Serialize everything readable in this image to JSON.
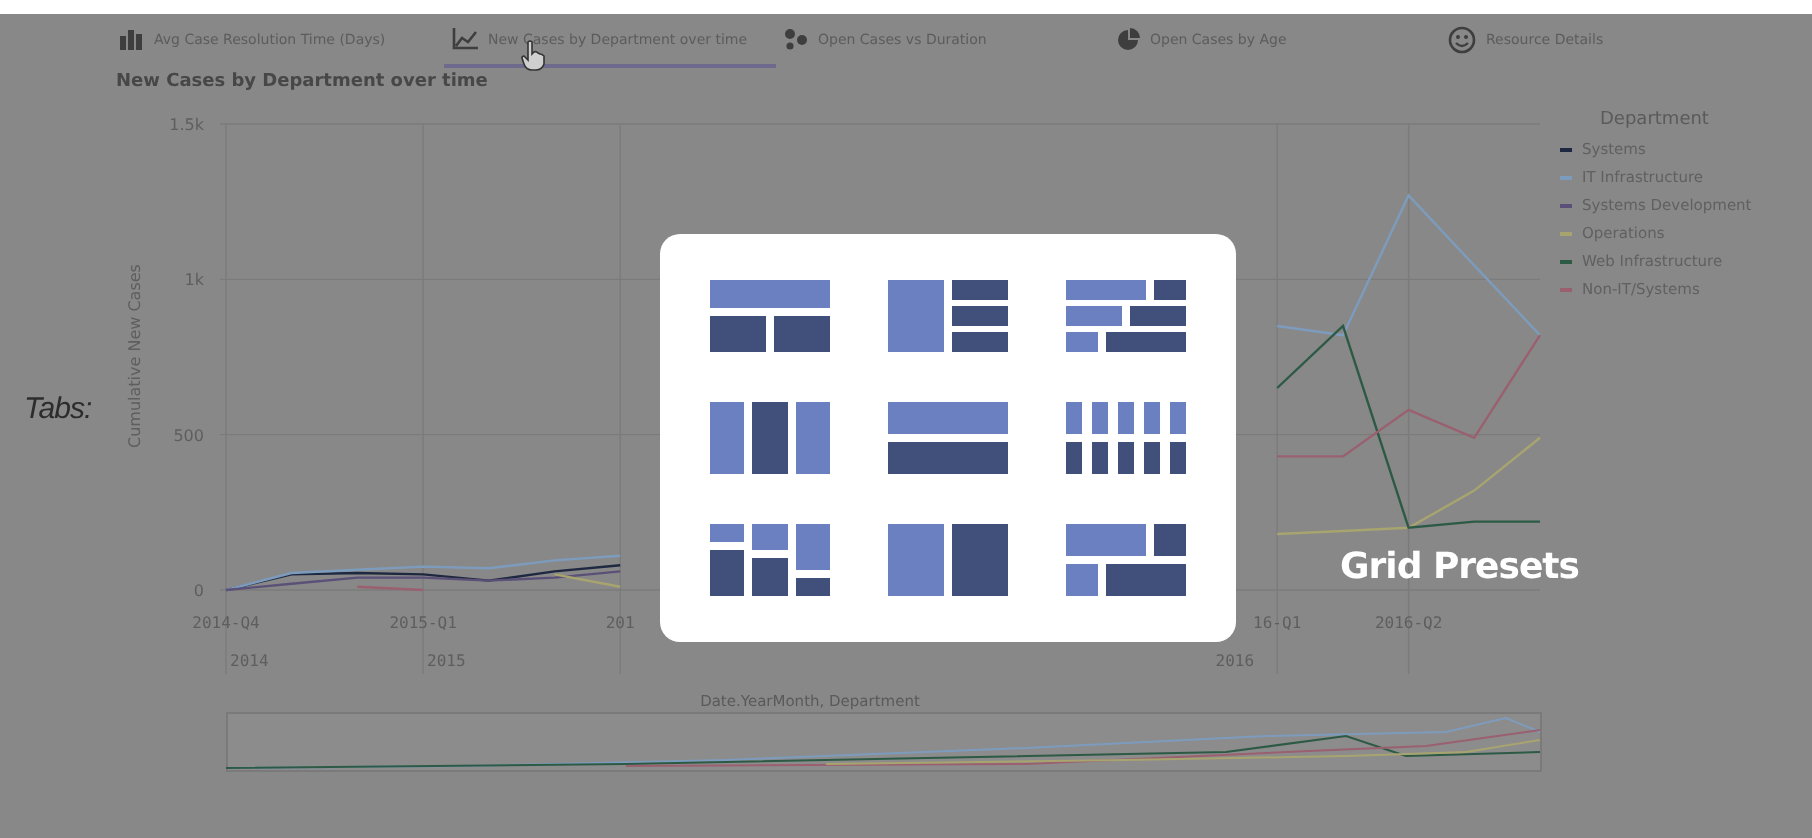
{
  "tabs": [
    {
      "label": "Avg Case Resolution Time (Days)",
      "kind": "bar",
      "selected": false
    },
    {
      "label": "New Cases by Department over time",
      "kind": "line",
      "selected": true
    },
    {
      "label": "Open Cases vs Duration",
      "kind": "scatter",
      "selected": false
    },
    {
      "label": "Open Cases by Age",
      "kind": "pie",
      "selected": false
    },
    {
      "label": "Resource Details",
      "kind": "smiley",
      "selected": false
    }
  ],
  "chart_data": {
    "type": "line",
    "title": "New Cases by Department over time",
    "xlabel": "Date.YearMonth, Department",
    "ylabel": "Cumulative New Cases",
    "categories": [
      "2014-Q4",
      null,
      null,
      "2015-Q1",
      null,
      null,
      "201",
      null,
      null,
      null,
      null,
      null,
      null,
      null,
      null,
      null,
      "16-Q1",
      null,
      "2016-Q2",
      null,
      null
    ],
    "ylim": [
      0,
      1500
    ],
    "grid": true,
    "series": [
      {
        "name": "Systems",
        "color": "#1e2840",
        "values": [
          0,
          50,
          55,
          50,
          30,
          60,
          80,
          null,
          null,
          null,
          null,
          null,
          null,
          null,
          null,
          null,
          null,
          null,
          null,
          null,
          null
        ]
      },
      {
        "name": "IT Infrastructure",
        "color": "#7d9cbd",
        "values": [
          0,
          55,
          65,
          75,
          70,
          95,
          110,
          null,
          null,
          null,
          null,
          null,
          null,
          null,
          null,
          null,
          850,
          820,
          1270,
          1045,
          820
        ]
      },
      {
        "name": "Systems Development",
        "color": "#5b5077",
        "values": [
          0,
          20,
          40,
          40,
          30,
          40,
          60,
          null,
          null,
          null,
          null,
          null,
          null,
          null,
          null,
          null,
          null,
          null,
          null,
          null,
          null
        ]
      },
      {
        "name": "Operations",
        "color": "#a8a470",
        "values": [
          null,
          null,
          null,
          null,
          null,
          50,
          10,
          null,
          null,
          null,
          null,
          null,
          null,
          null,
          null,
          null,
          180,
          190,
          200,
          320,
          490
        ]
      },
      {
        "name": "Web Infrastructure",
        "color": "#2d5a45",
        "values": [
          null,
          null,
          null,
          null,
          null,
          null,
          null,
          null,
          null,
          null,
          null,
          null,
          null,
          null,
          null,
          null,
          650,
          850,
          200,
          220,
          220
        ]
      },
      {
        "name": "Non-IT/Systems",
        "color": "#9a6070",
        "values": [
          null,
          null,
          10,
          0,
          null,
          null,
          null,
          null,
          null,
          null,
          null,
          null,
          null,
          null,
          null,
          null,
          430,
          430,
          580,
          490,
          820
        ]
      }
    ],
    "yticks": [
      {
        "value": 0,
        "label": "0"
      },
      {
        "value": 500,
        "label": "500"
      },
      {
        "value": 1000,
        "label": "1k"
      },
      {
        "value": 1500,
        "label": "1.5k"
      }
    ],
    "annotations": [
      "2014",
      "2015",
      "2016"
    ]
  },
  "legend": {
    "title": "Department"
  },
  "callouts": {
    "tabs": "Tabs:",
    "presets": "Grid Presets"
  }
}
